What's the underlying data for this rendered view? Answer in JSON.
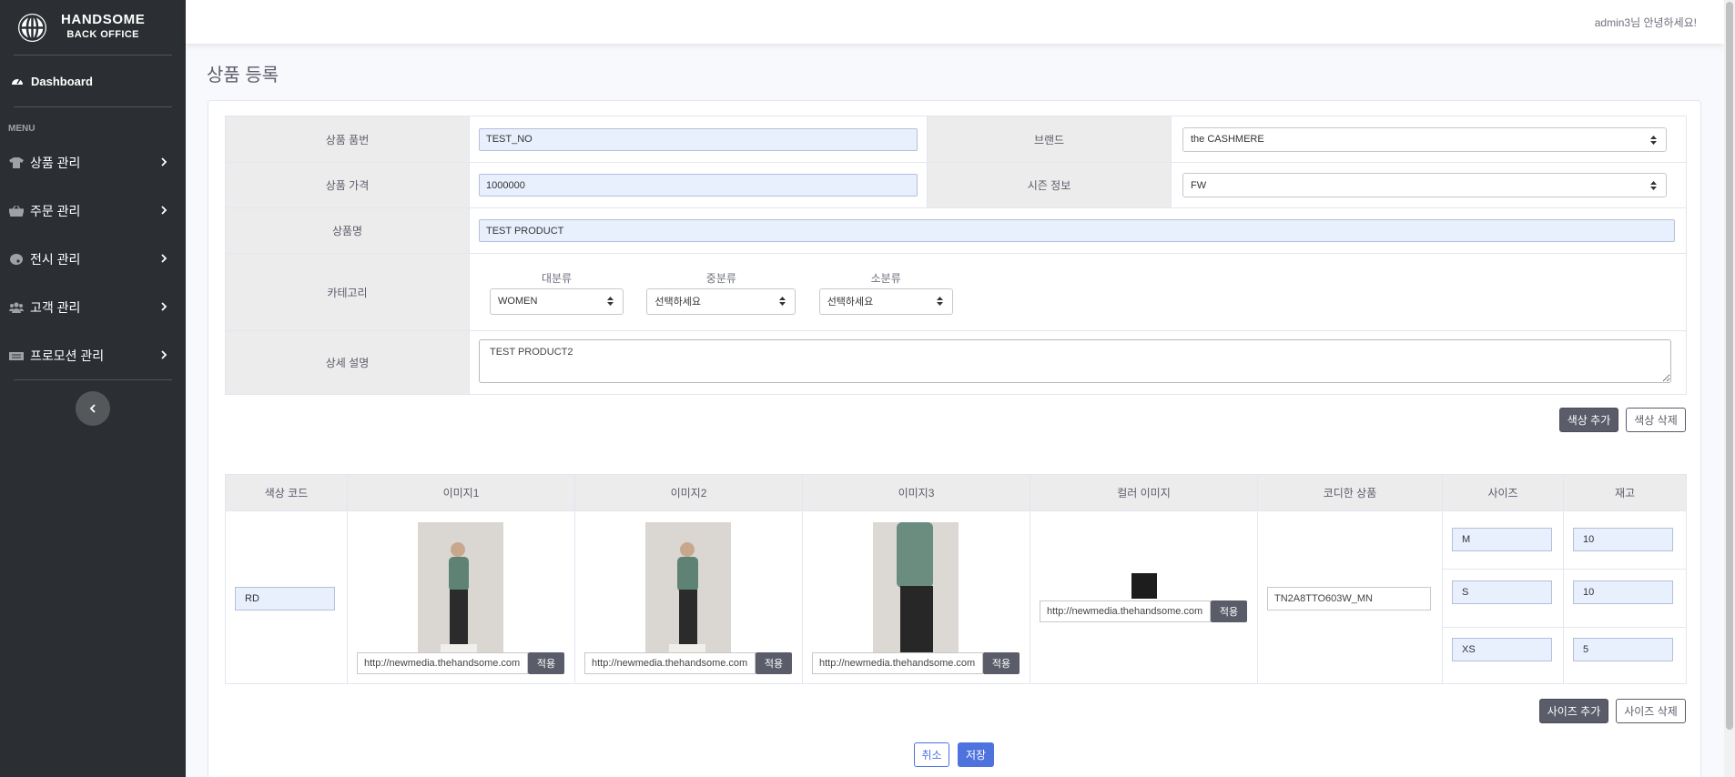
{
  "sidebar": {
    "brand_title": "HANDSOME",
    "brand_sub": "BACK OFFICE",
    "dashboard_label": "Dashboard",
    "menu_heading": "MENU",
    "items": [
      {
        "label": "상품 관리",
        "icon": "tshirt-icon"
      },
      {
        "label": "주문 관리",
        "icon": "basket-icon"
      },
      {
        "label": "전시 관리",
        "icon": "palette-icon"
      },
      {
        "label": "고객 관리",
        "icon": "users-icon"
      },
      {
        "label": "프로모션 관리",
        "icon": "ticket-icon"
      }
    ]
  },
  "topbar": {
    "greeting": "admin3님 안녕하세요!"
  },
  "page_title": "상품 등록",
  "form": {
    "product_no_label": "상품 품번",
    "product_no": "TEST_NO",
    "brand_label": "브랜드",
    "brand": "the CASHMERE",
    "price_label": "상품 가격",
    "price": "1000000",
    "season_label": "시즌 정보",
    "season": "FW",
    "name_label": "상품명",
    "name": "TEST PRODUCT",
    "category_label": "카테고리",
    "cat_large_label": "대분류",
    "cat_large": "WOMEN",
    "cat_mid_label": "중분류",
    "cat_mid": "선택하세요",
    "cat_small_label": "소분류",
    "cat_small": "선택하세요",
    "desc_label": "상세 설명",
    "desc": "TEST PRODUCT2"
  },
  "buttons": {
    "add_color": "색상 추가",
    "delete_color": "색상 삭제",
    "add_size": "사이즈 추가",
    "delete_size": "사이즈 삭제",
    "apply": "적용",
    "cancel": "취소",
    "save": "저장"
  },
  "color_table": {
    "headers": [
      "색상 코드",
      "이미지1",
      "이미지2",
      "이미지3",
      "컬러 이미지",
      "코디한 상품",
      "사이즈",
      "재고"
    ],
    "color_code": "RD",
    "image_urls": [
      "http://newmedia.thehandsome.com",
      "http://newmedia.thehandsome.com",
      "http://newmedia.thehandsome.com"
    ],
    "color_image_url": "http://newmedia.thehandsome.com",
    "coordinated_product": "TN2A8TTO603W_MN",
    "sizes": [
      {
        "size": "M",
        "stock": "10"
      },
      {
        "size": "S",
        "stock": "10"
      },
      {
        "size": "XS",
        "stock": "5"
      }
    ]
  }
}
